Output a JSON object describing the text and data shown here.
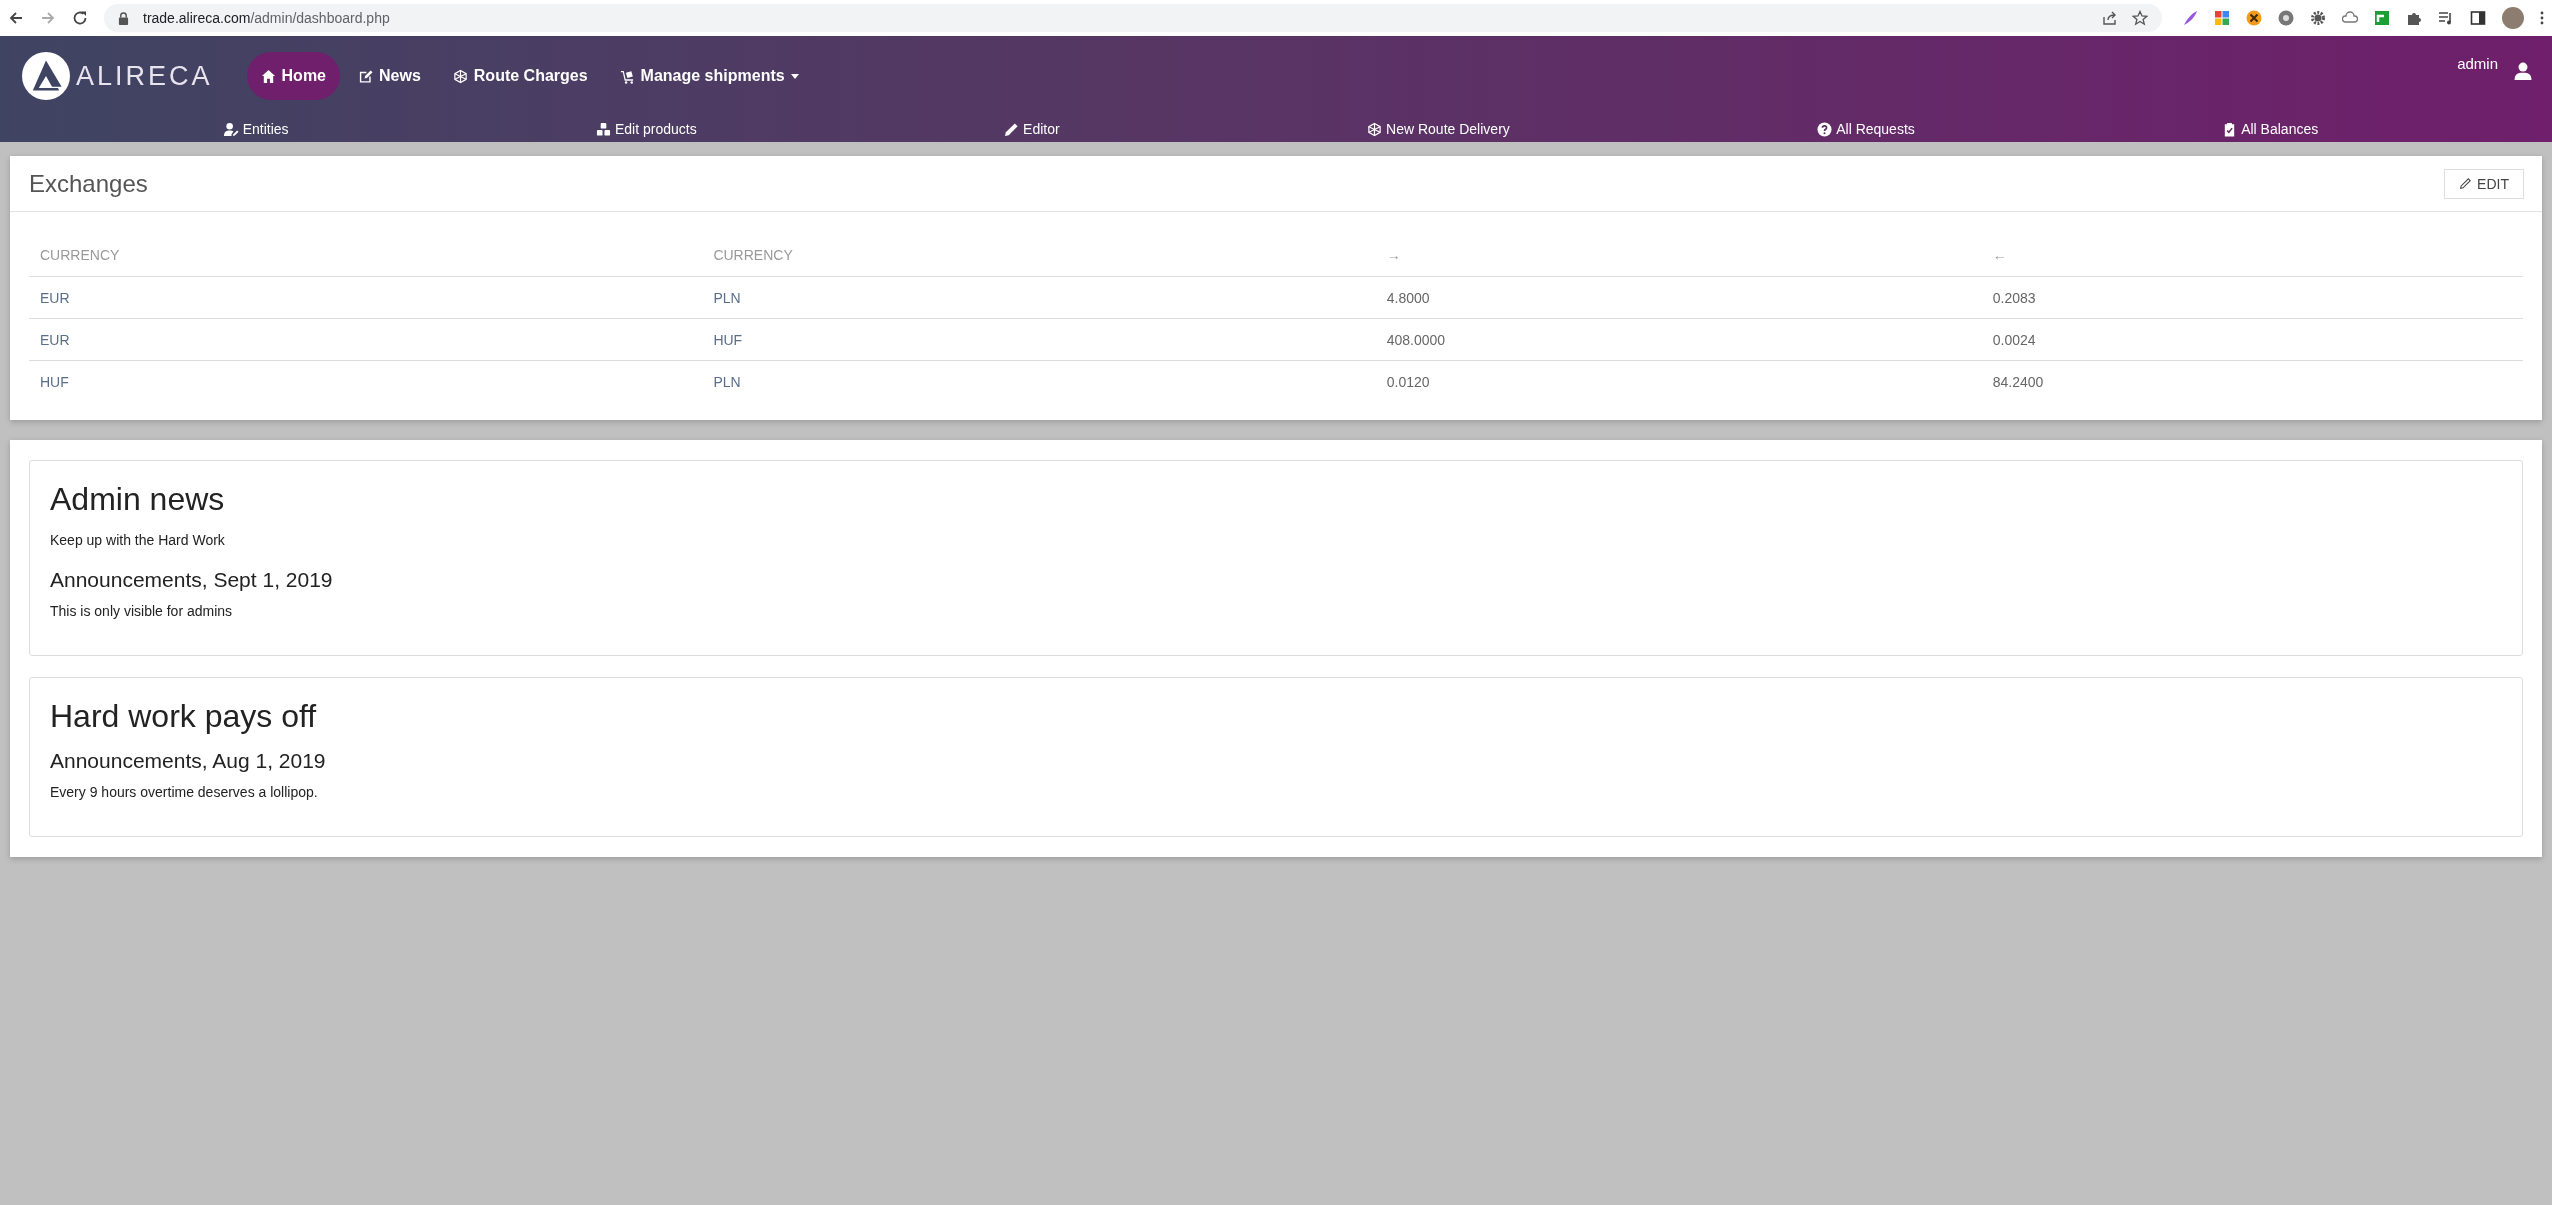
{
  "browser": {
    "url_host": "trade.alireca.com",
    "url_path": "/admin/dashboard.php"
  },
  "header": {
    "logo_text": "ALIRECA",
    "user": "admin",
    "main_nav": [
      {
        "label": "Home",
        "kind": "home",
        "selected": true,
        "dropdown": false
      },
      {
        "label": "News",
        "kind": "edit",
        "selected": false,
        "dropdown": false
      },
      {
        "label": "Route Charges",
        "kind": "network",
        "selected": false,
        "dropdown": false
      },
      {
        "label": "Manage shipments",
        "kind": "cart",
        "selected": false,
        "dropdown": true
      }
    ],
    "sub_nav": [
      {
        "label": "Entities",
        "kind": "user-edit"
      },
      {
        "label": "Edit products",
        "kind": "cubes"
      },
      {
        "label": "Editor",
        "kind": "pencil"
      },
      {
        "label": "New Route Delivery",
        "kind": "network"
      },
      {
        "label": "All Requests",
        "kind": "question"
      },
      {
        "label": "All Balances",
        "kind": "clipboard"
      }
    ]
  },
  "exchanges": {
    "title": "Exchanges",
    "edit_button": "EDIT",
    "columns": [
      "CURRENCY",
      "CURRENCY",
      "→",
      "←"
    ],
    "rows": [
      [
        "EUR",
        "PLN",
        "4.8000",
        "0.2083"
      ],
      [
        "EUR",
        "HUF",
        "408.0000",
        "0.0024"
      ],
      [
        "HUF",
        "PLN",
        "0.0120",
        "84.2400"
      ]
    ]
  },
  "news": [
    {
      "title": "Admin news",
      "subtitle": "Keep up with the Hard Work",
      "heading": "Announcements, Sept 1, 2019",
      "body": "This is only visible for admins"
    },
    {
      "title": "Hard work pays off",
      "heading": "Announcements, Aug 1, 2019",
      "body": "Every 9 hours overtime deserves a lollipop."
    }
  ]
}
